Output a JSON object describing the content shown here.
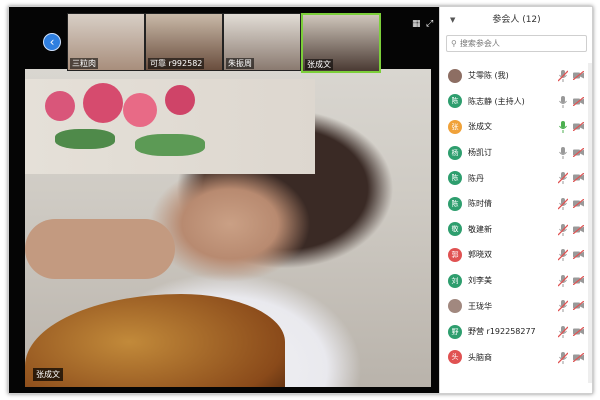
{
  "colors": {
    "accent": "#2f7fe0",
    "muted_red": "#e05252",
    "active_green": "#4caf50"
  },
  "thumbnails": [
    {
      "label": "三粒肉"
    },
    {
      "label": "可靠 r992582"
    },
    {
      "label": "朱振周"
    },
    {
      "label": "张成文",
      "active": true
    }
  ],
  "speaker": {
    "label": "张成文"
  },
  "panel": {
    "title": "参会人 (12)",
    "search_placeholder": "搜索参会人"
  },
  "participants": [
    {
      "name": "艾零陈 (我)",
      "avatar_text": "",
      "avatar_color": "#8d6e63",
      "mic": "muted",
      "cam": "off"
    },
    {
      "name": "陈志静 (主持人)",
      "avatar_text": "陈",
      "avatar_color": "#2e9e6e",
      "mic": "off",
      "cam": "off"
    },
    {
      "name": "张成文",
      "avatar_text": "张",
      "avatar_color": "#f0a23a",
      "mic": "on",
      "cam": "off"
    },
    {
      "name": "杨凯订",
      "avatar_text": "杨",
      "avatar_color": "#2e9e6e",
      "mic": "off",
      "cam": "off"
    },
    {
      "name": "陈丹",
      "avatar_text": "陈",
      "avatar_color": "#2e9e6e",
      "mic": "muted",
      "cam": "off"
    },
    {
      "name": "陈时倩",
      "avatar_text": "陈",
      "avatar_color": "#2e9e6e",
      "mic": "muted",
      "cam": "off"
    },
    {
      "name": "敬建新",
      "avatar_text": "敬",
      "avatar_color": "#2e9e6e",
      "mic": "muted",
      "cam": "off"
    },
    {
      "name": "郭晓双",
      "avatar_text": "郭",
      "avatar_color": "#e05252",
      "mic": "muted",
      "cam": "off"
    },
    {
      "name": "刘李美",
      "avatar_text": "刘",
      "avatar_color": "#2e9e6e",
      "mic": "muted",
      "cam": "off"
    },
    {
      "name": "王珑华",
      "avatar_text": "",
      "avatar_color": "#a1887f",
      "mic": "muted",
      "cam": "off"
    },
    {
      "name": "野营 r192258277",
      "avatar_text": "野",
      "avatar_color": "#2e9e6e",
      "mic": "muted",
      "cam": "off"
    },
    {
      "name": "头脑商",
      "avatar_text": "头",
      "avatar_color": "#e05252",
      "mic": "muted",
      "cam": "off"
    }
  ]
}
